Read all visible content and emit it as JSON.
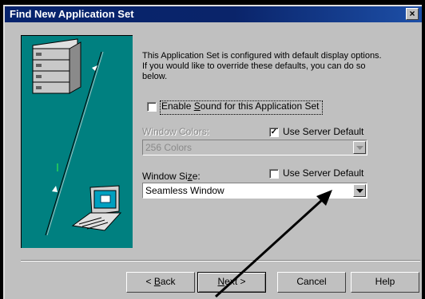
{
  "window": {
    "title": "Find New Application Set",
    "close_glyph": "×"
  },
  "description": "This Application Set is configured with default display options.  If you would like to override these defaults, you can do so below.",
  "enable_sound": {
    "checked": false,
    "label_pre": "Enable ",
    "label_mnemonic": "S",
    "label_post": "ound for this Application Set"
  },
  "window_colors": {
    "label": "Window Colors:",
    "value": "256 Colors",
    "enabled": false,
    "use_server_default": {
      "checked": true,
      "mark": "✓",
      "label": "Use Server Default"
    }
  },
  "window_size": {
    "label_pre": "Window Si",
    "label_mnemonic": "z",
    "label_post": "e:",
    "value": "Seamless Window",
    "use_server_default": {
      "checked": false,
      "label": "Use Server Default"
    }
  },
  "buttons": {
    "back": {
      "pre": "< ",
      "mnemonic": "B",
      "post": "ack"
    },
    "next": {
      "pre": "",
      "mnemonic": "N",
      "post": "ext >"
    },
    "cancel": "Cancel",
    "help": "Help"
  },
  "icons": {
    "close": "close-icon",
    "server": "server-stack-icon",
    "laptop": "laptop-icon",
    "dropdown": "chevron-down-icon"
  }
}
